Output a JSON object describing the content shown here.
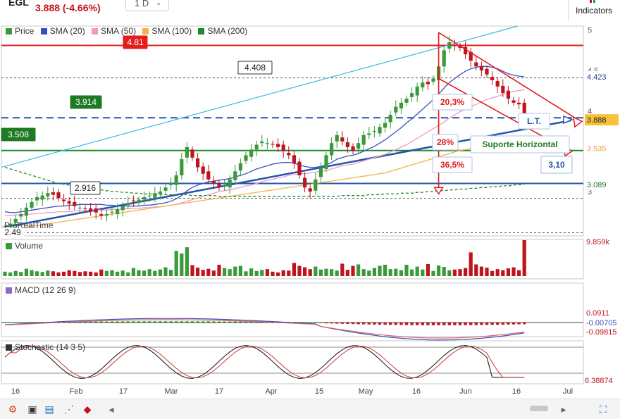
{
  "header": {
    "symbol": "EGL",
    "price_change": "3.888 (-4.66%)",
    "timeframe": "1 D",
    "indicators_label": "Indicators"
  },
  "legend": {
    "items": [
      {
        "label": "Price",
        "color": "#3a9a3a"
      },
      {
        "label": "SMA (20)",
        "color": "#3a4fbf"
      },
      {
        "label": "SMA (50)",
        "color": "#ee9ac6"
      },
      {
        "label": "SMA (100)",
        "color": "#f0b44a"
      },
      {
        "label": "SMA (200)",
        "color": "#1f8a2a"
      }
    ]
  },
  "panes": {
    "watermark": "ProRealTime",
    "volume_label": "Volume",
    "macd_label": "MACD (12 26 9)",
    "stoch_label": "Stochastic (14 3 5)"
  },
  "chart_data": {
    "type": "candlestick",
    "timeframe": "1 D",
    "ylim": [
      2.45,
      5.05
    ],
    "y_ticks": [
      "5",
      "4.5",
      "4",
      "3.5",
      "3"
    ],
    "x_ticks": [
      "16",
      "Feb",
      "17",
      "Mar",
      "17",
      "Apr",
      "15",
      "May",
      "16",
      "Jun",
      "16",
      "Jul"
    ],
    "closes": [
      2.55,
      2.6,
      2.66,
      2.72,
      2.8,
      2.87,
      2.93,
      2.95,
      2.98,
      2.96,
      2.92,
      2.88,
      2.85,
      2.82,
      2.8,
      2.78,
      2.76,
      2.74,
      2.7,
      2.72,
      2.75,
      2.78,
      2.82,
      2.86,
      2.88,
      2.9,
      2.93,
      2.95,
      2.98,
      3.0,
      3.05,
      3.1,
      3.2,
      3.4,
      3.55,
      3.42,
      3.3,
      3.22,
      3.15,
      3.1,
      3.05,
      3.08,
      3.15,
      3.25,
      3.35,
      3.45,
      3.52,
      3.58,
      3.62,
      3.6,
      3.58,
      3.55,
      3.5,
      3.45,
      3.35,
      3.2,
      3.05,
      3.0,
      3.15,
      3.3,
      3.45,
      3.6,
      3.7,
      3.62,
      3.55,
      3.5,
      3.6,
      3.7,
      3.72,
      3.75,
      3.8,
      3.85,
      3.95,
      4.05,
      4.1,
      4.15,
      4.22,
      4.3,
      4.35,
      4.33,
      4.4,
      4.55,
      4.75,
      4.85,
      4.81,
      4.78,
      4.7,
      4.62,
      4.55,
      4.5,
      4.45,
      4.38,
      4.3,
      4.22,
      4.15,
      4.1,
      4.08,
      3.888
    ],
    "series": [
      {
        "name": "SMA (20)",
        "values": [
          2.75,
          2.74,
          2.74,
          2.75,
          2.76,
          2.77,
          2.78,
          2.79,
          2.8,
          2.81,
          2.82,
          2.82,
          2.83,
          2.83,
          2.84,
          2.84,
          2.84,
          2.84,
          2.84,
          2.83,
          2.83,
          2.82,
          2.82,
          2.82,
          2.82,
          2.82,
          2.83,
          2.83,
          2.84,
          2.85,
          2.86,
          2.88,
          2.91,
          2.95,
          3.01,
          3.05,
          3.08,
          3.1,
          3.12,
          3.13,
          3.14,
          3.15,
          3.16,
          3.18,
          3.2,
          3.22,
          3.25,
          3.28,
          3.3,
          3.32,
          3.34,
          3.35,
          3.36,
          3.36,
          3.35,
          3.33,
          3.31,
          3.3,
          3.3,
          3.31,
          3.33,
          3.36,
          3.4,
          3.42,
          3.44,
          3.45,
          3.47,
          3.5,
          3.53,
          3.56,
          3.6,
          3.64,
          3.69,
          3.74,
          3.79,
          3.85,
          3.9,
          3.96,
          4.02,
          4.08,
          4.14,
          4.21,
          4.28,
          4.35,
          4.4,
          4.45,
          4.49,
          4.52,
          4.54,
          4.55,
          4.55,
          4.54,
          4.52,
          4.49,
          4.46,
          4.44,
          4.43,
          4.423
        ]
      },
      {
        "name": "SMA (50)",
        "values": [
          2.7,
          2.7,
          2.71,
          2.71,
          2.72,
          2.72,
          2.73,
          2.73,
          2.74,
          2.74,
          2.75,
          2.75,
          2.75,
          2.76,
          2.76,
          2.76,
          2.77,
          2.77,
          2.77,
          2.77,
          2.78,
          2.78,
          2.78,
          2.79,
          2.79,
          2.79,
          2.8,
          2.8,
          2.81,
          2.81,
          2.82,
          2.83,
          2.84,
          2.86,
          2.88,
          2.9,
          2.92,
          2.94,
          2.96,
          2.98,
          3.0,
          3.01,
          3.02,
          3.04,
          3.05,
          3.07,
          3.08,
          3.1,
          3.12,
          3.14,
          3.15,
          3.17,
          3.18,
          3.2,
          3.21,
          3.22,
          3.22,
          3.23,
          3.24,
          3.25,
          3.26,
          3.28,
          3.3,
          3.32,
          3.33,
          3.34,
          3.36,
          3.38,
          3.4,
          3.42,
          3.44,
          3.46,
          3.49,
          3.52,
          3.55,
          3.58,
          3.62,
          3.66,
          3.7,
          3.74,
          3.78,
          3.82,
          3.86,
          3.91,
          3.95,
          3.99,
          4.02,
          4.05,
          4.08,
          4.11,
          4.14,
          4.16,
          4.18,
          4.2,
          4.22,
          4.24,
          4.25,
          4.26
        ]
      },
      {
        "name": "SMA (100)",
        "values": [
          2.52,
          2.53,
          2.54,
          2.55,
          2.56,
          2.57,
          2.58,
          2.59,
          2.6,
          2.61,
          2.62,
          2.63,
          2.64,
          2.65,
          2.66,
          2.67,
          2.68,
          2.69,
          2.7,
          2.71,
          2.72,
          2.73,
          2.74,
          2.75,
          2.76,
          2.77,
          2.78,
          2.79,
          2.8,
          2.81,
          2.82,
          2.83,
          2.84,
          2.85,
          2.86,
          2.87,
          2.88,
          2.89,
          2.9,
          2.91,
          2.92,
          2.93,
          2.94,
          2.95,
          2.96,
          2.97,
          2.98,
          2.99,
          3.0,
          3.01,
          3.02,
          3.03,
          3.04,
          3.05,
          3.06,
          3.07,
          3.08,
          3.09,
          3.1,
          3.11,
          3.12,
          3.13,
          3.14,
          3.15,
          3.16,
          3.17,
          3.18,
          3.19,
          3.2,
          3.21,
          3.22,
          3.23,
          3.25,
          3.27,
          3.29,
          3.31,
          3.33,
          3.35,
          3.37,
          3.39,
          3.41,
          3.43,
          3.45,
          3.47,
          3.49,
          3.51,
          3.52,
          3.53,
          3.54,
          3.55,
          3.55,
          3.55,
          3.54,
          3.54,
          3.54,
          3.54,
          3.535,
          3.535
        ]
      },
      {
        "name": "SMA (200)",
        "values": [
          3.3,
          3.28,
          3.26,
          3.24,
          3.22,
          3.2,
          3.18,
          3.16,
          3.14,
          3.12,
          3.1,
          3.09,
          3.08,
          3.07,
          3.06,
          3.05,
          3.04,
          3.03,
          3.02,
          3.01,
          3.0,
          3.0,
          2.99,
          2.99,
          2.98,
          2.98,
          2.97,
          2.97,
          2.97,
          2.96,
          2.96,
          2.96,
          2.96,
          2.96,
          2.96,
          2.95,
          2.95,
          2.95,
          2.95,
          2.95,
          2.94,
          2.94,
          2.94,
          2.94,
          2.94,
          2.94,
          2.94,
          2.94,
          2.94,
          2.94,
          2.94,
          2.94,
          2.94,
          2.94,
          2.94,
          2.94,
          2.94,
          2.94,
          2.94,
          2.94,
          2.94,
          2.94,
          2.94,
          2.95,
          2.95,
          2.95,
          2.95,
          2.95,
          2.96,
          2.96,
          2.96,
          2.97,
          2.97,
          2.97,
          2.98,
          2.98,
          2.98,
          2.99,
          2.99,
          3.0,
          3.0,
          3.01,
          3.01,
          3.02,
          3.02,
          3.03,
          3.03,
          3.04,
          3.04,
          3.05,
          3.05,
          3.06,
          3.06,
          3.07,
          3.07,
          3.08,
          3.085,
          3.089
        ]
      }
    ],
    "price_tags": {
      "last": "3.888",
      "sma20": "4.423",
      "sma100": "3.535",
      "sma200": "3.089"
    },
    "levels": [
      {
        "label": "4.81",
        "value": 4.81,
        "color": "#e31c1c"
      },
      {
        "label": "4.408",
        "value": 4.408,
        "color": "#555555"
      },
      {
        "label": "3.914",
        "value": 3.914,
        "color": "#2156a8"
      },
      {
        "label": "3.508",
        "value": 3.508,
        "color": "#1f8a2a"
      },
      {
        "label": "3,10",
        "value": 3.1,
        "color": "#2156a8"
      },
      {
        "label": "2.916",
        "value": 2.916,
        "color": "#555555"
      },
      {
        "label": "2.49",
        "value": 2.49,
        "color": "#555555"
      }
    ],
    "annotations": [
      "20,3%",
      "28%",
      "36,5%",
      "L.T.",
      "Suporte Horizontal"
    ],
    "volume": {
      "max_label": "9.859k",
      "values": [
        1.2,
        1.0,
        1.4,
        1.1,
        2.0,
        1.6,
        1.3,
        1.1,
        1.5,
        1.3,
        1.0,
        1.2,
        1.6,
        1.4,
        1.1,
        1.3,
        1.2,
        1.0,
        1.8,
        1.4,
        1.6,
        1.2,
        1.5,
        1.0,
        2.2,
        1.6,
        1.5,
        1.9,
        1.4,
        1.8,
        2.4,
        1.7,
        6.9,
        6.2,
        7.9,
        3.0,
        2.3,
        1.7,
        2.0,
        1.5,
        3.1,
        2.2,
        1.9,
        2.6,
        2.8,
        1.3,
        2.1,
        1.4,
        1.7,
        1.9,
        1.2,
        1.0,
        1.6,
        1.5,
        3.6,
        2.8,
        2.4,
        1.9,
        2.6,
        1.8,
        2.0,
        1.9,
        1.5,
        3.4,
        1.7,
        2.8,
        3.2,
        1.9,
        1.5,
        2.2,
        2.8,
        3.1,
        1.9,
        2.0,
        1.6,
        3.1,
        1.8,
        2.6,
        1.8,
        3.3,
        1.4,
        2.9,
        2.5,
        1.6,
        1.8,
        1.9,
        2.2,
        6.5,
        3.2,
        2.6,
        2.3,
        1.4,
        1.9,
        1.6,
        2.1,
        2.4,
        1.6,
        9.859
      ]
    },
    "macd": {
      "tags": [
        "0.0911",
        "-0.00705",
        "-0.09815"
      ]
    },
    "stochastic": {
      "tag": "6.38874"
    }
  }
}
